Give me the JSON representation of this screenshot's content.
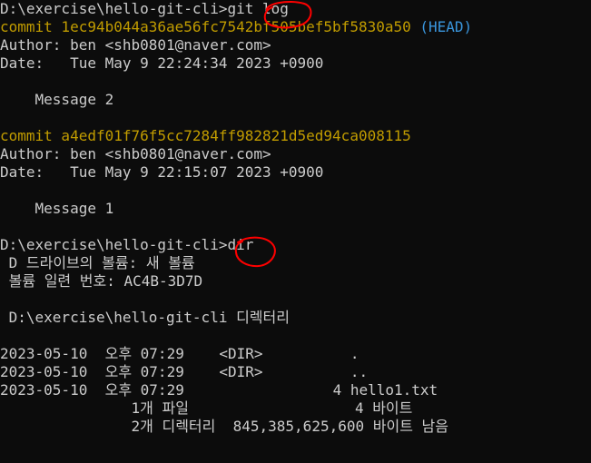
{
  "terminal": {
    "lines": {
      "prompt1": "D:\\exercise\\hello-git-cli>git log",
      "commit1": "commit 1ec94b044a36ae56fc7542bf505bef5bf5830a50 ",
      "commit1_ref": "(HEAD)",
      "author1": "Author: ben <shb0801@naver.com>",
      "date1": "Date:   Tue May 9 22:24:34 2023 +0900",
      "message1": "    Message 2",
      "commit2": "commit a4edf01f76f5cc7284ff982821d5ed94ca008115",
      "author2": "Author: ben <shb0801@naver.com>",
      "date2": "Date:   Tue May 9 22:15:07 2023 +0900",
      "message2": "    Message 1",
      "prompt2": "D:\\exercise\\hello-git-cli>dir",
      "volume": " D 드라이브의 볼륨: 새 볼륨",
      "serial": " 볼륨 일련 번호: AC4B-3D7D",
      "dirhead": " D:\\exercise\\hello-git-cli 디렉터리",
      "entry1": "2023-05-10  오후 07:29    <DIR>          .",
      "entry2": "2023-05-10  오후 07:29    <DIR>          ..",
      "entry3": "2023-05-10  오후 07:29                 4 hello1.txt",
      "summary1": "               1개 파일                   4 바이트",
      "summary2": "               2개 디렉터리  845,385,625,600 바이트 남음"
    }
  },
  "colors": {
    "background": "#0c0c0c",
    "text": "#cccccc",
    "commit": "#c19c00",
    "head_ref": "#3a96dd",
    "annotation": "#ff0000"
  }
}
